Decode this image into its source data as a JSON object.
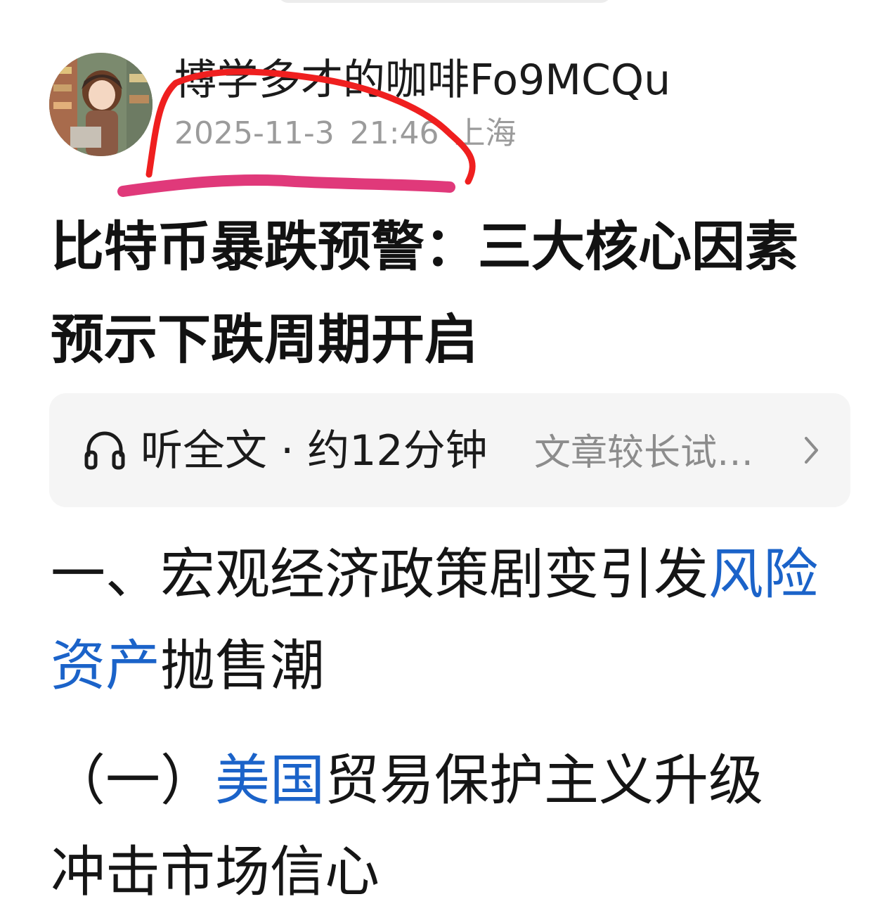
{
  "author": {
    "name": "博学多才的咖啡Fo9MCQu",
    "date": "2025-11-3",
    "time": "21:46",
    "location": "上海"
  },
  "article": {
    "title": "比特币暴跌预警：三大核心因素预示下跌周期开启"
  },
  "audio": {
    "label": "听全文 · 约12分钟",
    "hint": "文章较长试…"
  },
  "section1": {
    "prefix": "一、宏观经济政策剧变引发",
    "link": "风险资产",
    "suffix": "抛售潮"
  },
  "section2": {
    "prefix": "（一）",
    "link": "美国",
    "suffix": "贸易保护主义升级",
    "next_line": "冲击市场信心"
  },
  "colors": {
    "link": "#1b63c9",
    "scribble_red": "#ef1f1f",
    "scribble_pink": "#e0397a"
  },
  "icons": [
    "headphones-icon",
    "chevron-right-icon"
  ]
}
